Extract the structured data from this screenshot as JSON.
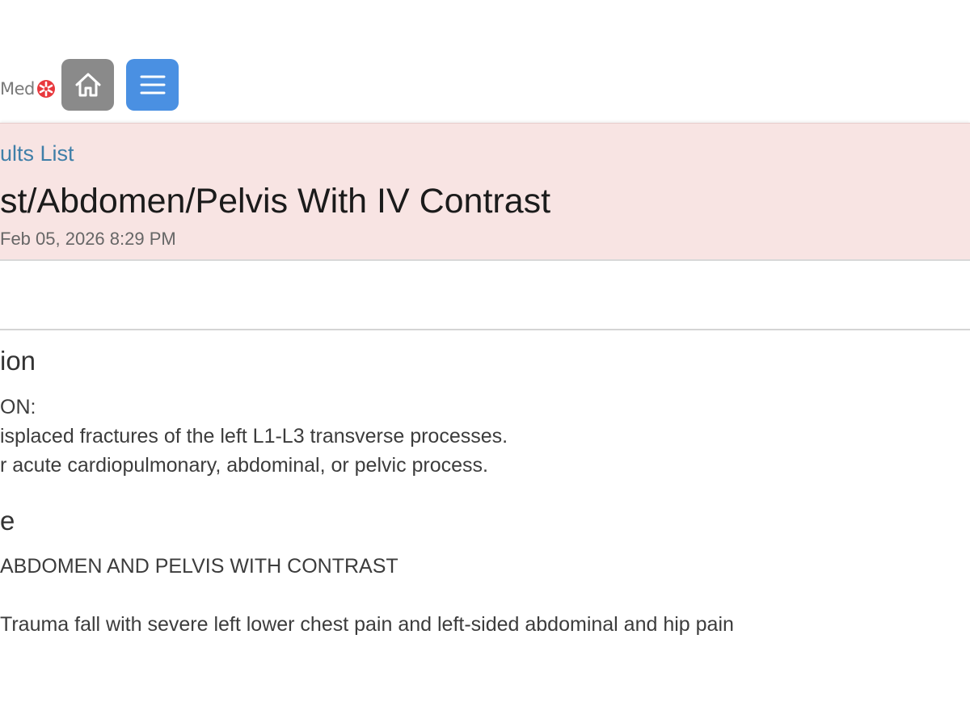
{
  "brand": {
    "logo_text": "Med",
    "logo_accent_color": "#e8383d"
  },
  "toolbar": {
    "home_icon": "home-icon",
    "menu_icon": "hamburger-menu-icon",
    "home_button_color": "#8a8a8a",
    "menu_button_color": "#4a90e2"
  },
  "header": {
    "back_link": "ults List",
    "title": "st/Abdomen/Pelvis With IV Contrast",
    "date": "Feb 05, 2026 8:29 PM",
    "background_color": "#f8e4e3"
  },
  "sections": {
    "impression": {
      "heading": "ion",
      "lines": [
        "ON:",
        "isplaced fractures of the left L1-L3 transverse processes.",
        "r acute cardiopulmonary, abdominal, or pelvic process."
      ]
    },
    "procedure": {
      "heading": "e",
      "lines": [
        "ABDOMEN AND PELVIS WITH CONTRAST",
        "Trauma fall with severe left lower chest pain and left-sided abdominal and hip pain"
      ]
    }
  }
}
